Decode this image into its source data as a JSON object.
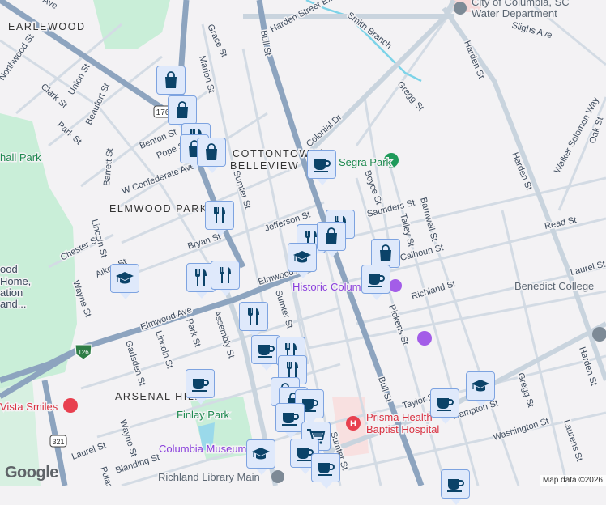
{
  "neighborhoods": {
    "earlewood": "EARLEWOOD",
    "cottontown": "COTTONTOWN/",
    "belleview": "BELLEVIEW",
    "elmwood_park": "ELMWOOD PARK",
    "arsenal_hill": "ARSENAL HILL"
  },
  "streets": {
    "harden_ext": "Harden Street Extension",
    "smith_branch": "Smith Branch",
    "bull_st": "Bull St",
    "grace": "Grace St",
    "marion": "Marion St",
    "ave_top": "Ave",
    "northwood": "Northwood St",
    "union": "Union St",
    "clark": "Clark St",
    "beaufort": "Beaufort St",
    "park": "Park St",
    "benton": "Benton St",
    "pope": "Pope St",
    "barrett": "Barrett St",
    "confederate": "W Confederate Ave",
    "sumter": "Sumter St",
    "jefferson": "Jefferson St",
    "bryan": "Bryan St",
    "lincoln": "Lincoln St",
    "chester": "Chester St",
    "aiken": "Aiken St",
    "wayne": "Wayne St",
    "elmwood": "Elmwood Ave",
    "gadsden": "Gadsden St",
    "assembly": "Assembly St",
    "laurel": "Laurel St",
    "blanding": "Blanding St",
    "pulaski": "Pulaski St",
    "colonial": "Colonial Dr",
    "gregg": "Gregg St",
    "harden": "Harden St",
    "slighs": "Slighs Ave",
    "boyce": "Boyce St",
    "saunders": "Saunders St",
    "talley": "Talley St",
    "barnwell": "Barnwell St",
    "walker": "Walker Solomon Way",
    "oak": "Oak St",
    "read": "Read St",
    "calhoun": "Calhoun St",
    "richland": "Richland St",
    "pickens": "Pickens St",
    "taylor": "Taylor St",
    "hampton": "Hampton St",
    "washington": "Washington St",
    "laurens": "Laurens St",
    "bull_lower": "Bull St",
    "gregg_lower": "Gregg St",
    "harden_lower": "Harden St",
    "laurel_right": "Laurel St",
    "sumter_lower": "Sumter St"
  },
  "shields": {
    "us176": "176",
    "i126": "126",
    "us321": "321"
  },
  "pois": {
    "water_dept_1": "City of Columbia, SC",
    "water_dept_2": "Water Department",
    "segra_park": "Segra Park",
    "marshall_park": "hall Park",
    "home_1": "ood",
    "home_2": "Home,",
    "home_3": "ation",
    "home_4": "and...",
    "historic": "Historic Colum",
    "benedict": "Benedict College",
    "vista": "Vista Smiles",
    "finlay": "Finlay Park",
    "prisma_1": "Prisma Health",
    "prisma_2": "Baptist Hospital",
    "museum": "Columbia Museum of Art",
    "library": "Richland Library Main"
  },
  "markers": [
    "shopping",
    "shopping",
    "restaurant",
    "shopping",
    "shopping",
    "restaurant",
    "coffee",
    "restaurant",
    "restaurant",
    "shopping",
    "education",
    "shopping",
    "coffee",
    "restaurant",
    "restaurant",
    "education",
    "restaurant",
    "coffee",
    "restaurant",
    "restaurant",
    "coffee",
    "shopping",
    "shopping",
    "coffee",
    "coffee",
    "grocery",
    "education",
    "coffee",
    "coffee",
    "coffee",
    "education",
    "coffee"
  ],
  "footer": {
    "google": "Google",
    "attribution": "Map data ©2026"
  },
  "colors": {
    "marker_bg": "#dfe9fb",
    "marker_icon": "#0b4369",
    "highway": "#8da4bf",
    "park": "#c9eed8"
  }
}
